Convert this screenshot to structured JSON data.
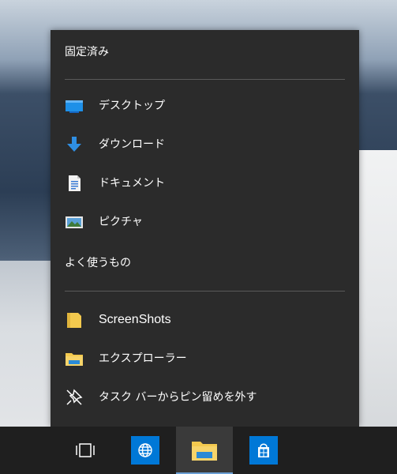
{
  "jumplist": {
    "pinned_header": "固定済み",
    "pinned_items": [
      {
        "label": "デスクトップ",
        "icon": "desktop-folder-icon"
      },
      {
        "label": "ダウンロード",
        "icon": "download-folder-icon"
      },
      {
        "label": "ドキュメント",
        "icon": "documents-folder-icon"
      },
      {
        "label": "ピクチャ",
        "icon": "pictures-folder-icon"
      }
    ],
    "frequent_header": "よく使うもの",
    "frequent_items": [
      {
        "label": "ScreenShots",
        "icon": "folder-icon"
      }
    ],
    "actions": [
      {
        "label": "エクスプローラー",
        "icon": "file-explorer-icon"
      },
      {
        "label": "タスク バーからピン留めを外す",
        "icon": "unpin-icon"
      }
    ]
  },
  "taskbar": {
    "buttons": [
      {
        "name": "task-view",
        "icon": "task-view-icon"
      },
      {
        "name": "internet-explorer",
        "icon": "globe-icon"
      },
      {
        "name": "file-explorer",
        "icon": "file-explorer-icon",
        "active": true
      },
      {
        "name": "store",
        "icon": "store-icon"
      }
    ]
  },
  "colors": {
    "menu_bg": "#2b2b2b",
    "taskbar_bg": "#1f1f1f",
    "accent": "#0078d7",
    "folder_yellow": "#f3c94e"
  }
}
